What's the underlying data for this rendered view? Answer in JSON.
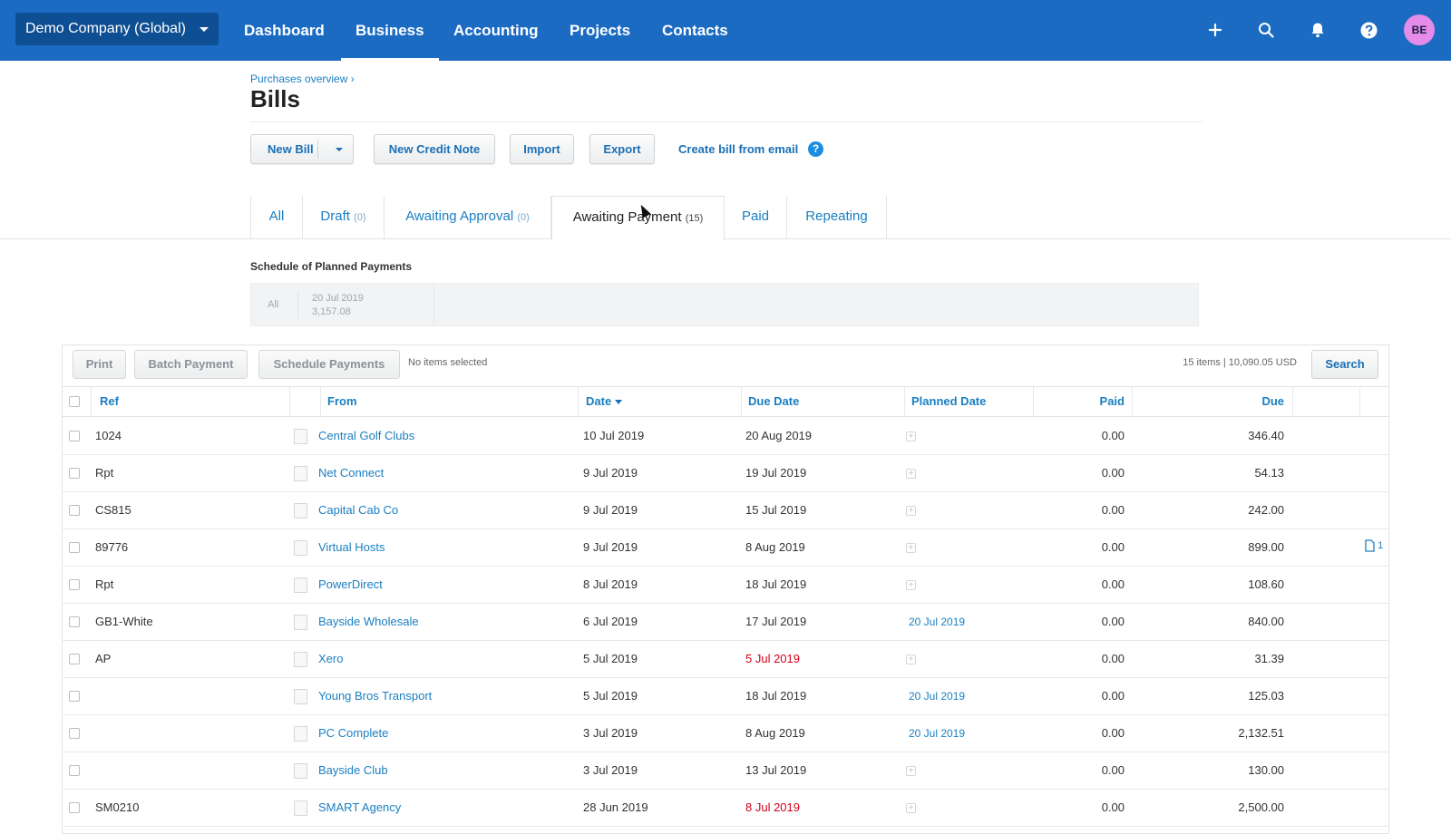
{
  "topbar": {
    "org": "Demo Company (Global)",
    "nav": [
      "Dashboard",
      "Business",
      "Accounting",
      "Projects",
      "Contacts"
    ],
    "active": "Business",
    "avatar": "BE",
    "icons": [
      "plus-icon",
      "search-icon",
      "bell-icon",
      "help-icon"
    ]
  },
  "header": {
    "breadcrumb": "Purchases overview ›",
    "title": "Bills"
  },
  "actions": {
    "new_bill": "New Bill",
    "new_credit_note": "New Credit Note",
    "import": "Import",
    "export": "Export",
    "create_from_email": "Create bill from email",
    "help": "?"
  },
  "tabs": [
    {
      "label": "All",
      "count": ""
    },
    {
      "label": "Draft",
      "count": "(0)"
    },
    {
      "label": "Awaiting Approval",
      "count": "(0)"
    },
    {
      "label": "Awaiting Payment",
      "count": "(15)"
    },
    {
      "label": "Paid",
      "count": ""
    },
    {
      "label": "Repeating",
      "count": ""
    }
  ],
  "schedule": {
    "title": "Schedule of Planned Payments",
    "all": "All",
    "date": "20 Jul 2019",
    "amount": "3,157.08"
  },
  "toolbar": {
    "print": "Print",
    "batch_payment": "Batch Payment",
    "schedule_payments": "Schedule Payments",
    "selection": "No items selected",
    "totals": "15 items | 10,090.05 USD",
    "search": "Search"
  },
  "columns": {
    "ref": "Ref",
    "from": "From",
    "date": "Date",
    "due_date": "Due Date",
    "planned_date": "Planned Date",
    "paid": "Paid",
    "due": "Due"
  },
  "rows": [
    {
      "ref": "1024",
      "from": "Central Golf Clubs",
      "date": "10 Jul 2019",
      "due_date": "20 Aug 2019",
      "overdue": false,
      "planned": "",
      "paid": "0.00",
      "due": "346.40",
      "attach": ""
    },
    {
      "ref": "Rpt",
      "from": "Net Connect",
      "date": "9 Jul 2019",
      "due_date": "19 Jul 2019",
      "overdue": false,
      "planned": "",
      "paid": "0.00",
      "due": "54.13",
      "attach": ""
    },
    {
      "ref": "CS815",
      "from": "Capital Cab Co",
      "date": "9 Jul 2019",
      "due_date": "15 Jul 2019",
      "overdue": false,
      "planned": "",
      "paid": "0.00",
      "due": "242.00",
      "attach": ""
    },
    {
      "ref": "89776",
      "from": "Virtual Hosts",
      "date": "9 Jul 2019",
      "due_date": "8 Aug 2019",
      "overdue": false,
      "planned": "",
      "paid": "0.00",
      "due": "899.00",
      "attach": "1"
    },
    {
      "ref": "Rpt",
      "from": "PowerDirect",
      "date": "8 Jul 2019",
      "due_date": "18 Jul 2019",
      "overdue": false,
      "planned": "",
      "paid": "0.00",
      "due": "108.60",
      "attach": ""
    },
    {
      "ref": "GB1-White",
      "from": "Bayside Wholesale",
      "date": "6 Jul 2019",
      "due_date": "17 Jul 2019",
      "overdue": false,
      "planned": "20 Jul 2019",
      "paid": "0.00",
      "due": "840.00",
      "attach": ""
    },
    {
      "ref": "AP",
      "from": "Xero",
      "date": "5 Jul 2019",
      "due_date": "5 Jul 2019",
      "overdue": true,
      "planned": "",
      "paid": "0.00",
      "due": "31.39",
      "attach": ""
    },
    {
      "ref": "",
      "from": "Young Bros Transport",
      "date": "5 Jul 2019",
      "due_date": "18 Jul 2019",
      "overdue": false,
      "planned": "20 Jul 2019",
      "paid": "0.00",
      "due": "125.03",
      "attach": ""
    },
    {
      "ref": "",
      "from": "PC Complete",
      "date": "3 Jul 2019",
      "due_date": "8 Aug 2019",
      "overdue": false,
      "planned": "20 Jul 2019",
      "paid": "0.00",
      "due": "2,132.51",
      "attach": ""
    },
    {
      "ref": "",
      "from": "Bayside Club",
      "date": "3 Jul 2019",
      "due_date": "13 Jul 2019",
      "overdue": false,
      "planned": "",
      "paid": "0.00",
      "due": "130.00",
      "attach": ""
    },
    {
      "ref": "SM0210",
      "from": "SMART Agency",
      "date": "28 Jun 2019",
      "due_date": "8 Jul 2019",
      "overdue": true,
      "planned": "",
      "paid": "0.00",
      "due": "2,500.00",
      "attach": ""
    }
  ],
  "colors": {
    "nav_bg": "#1c6bc2",
    "link": "#1a7fc1",
    "overdue": "#d0021b"
  }
}
